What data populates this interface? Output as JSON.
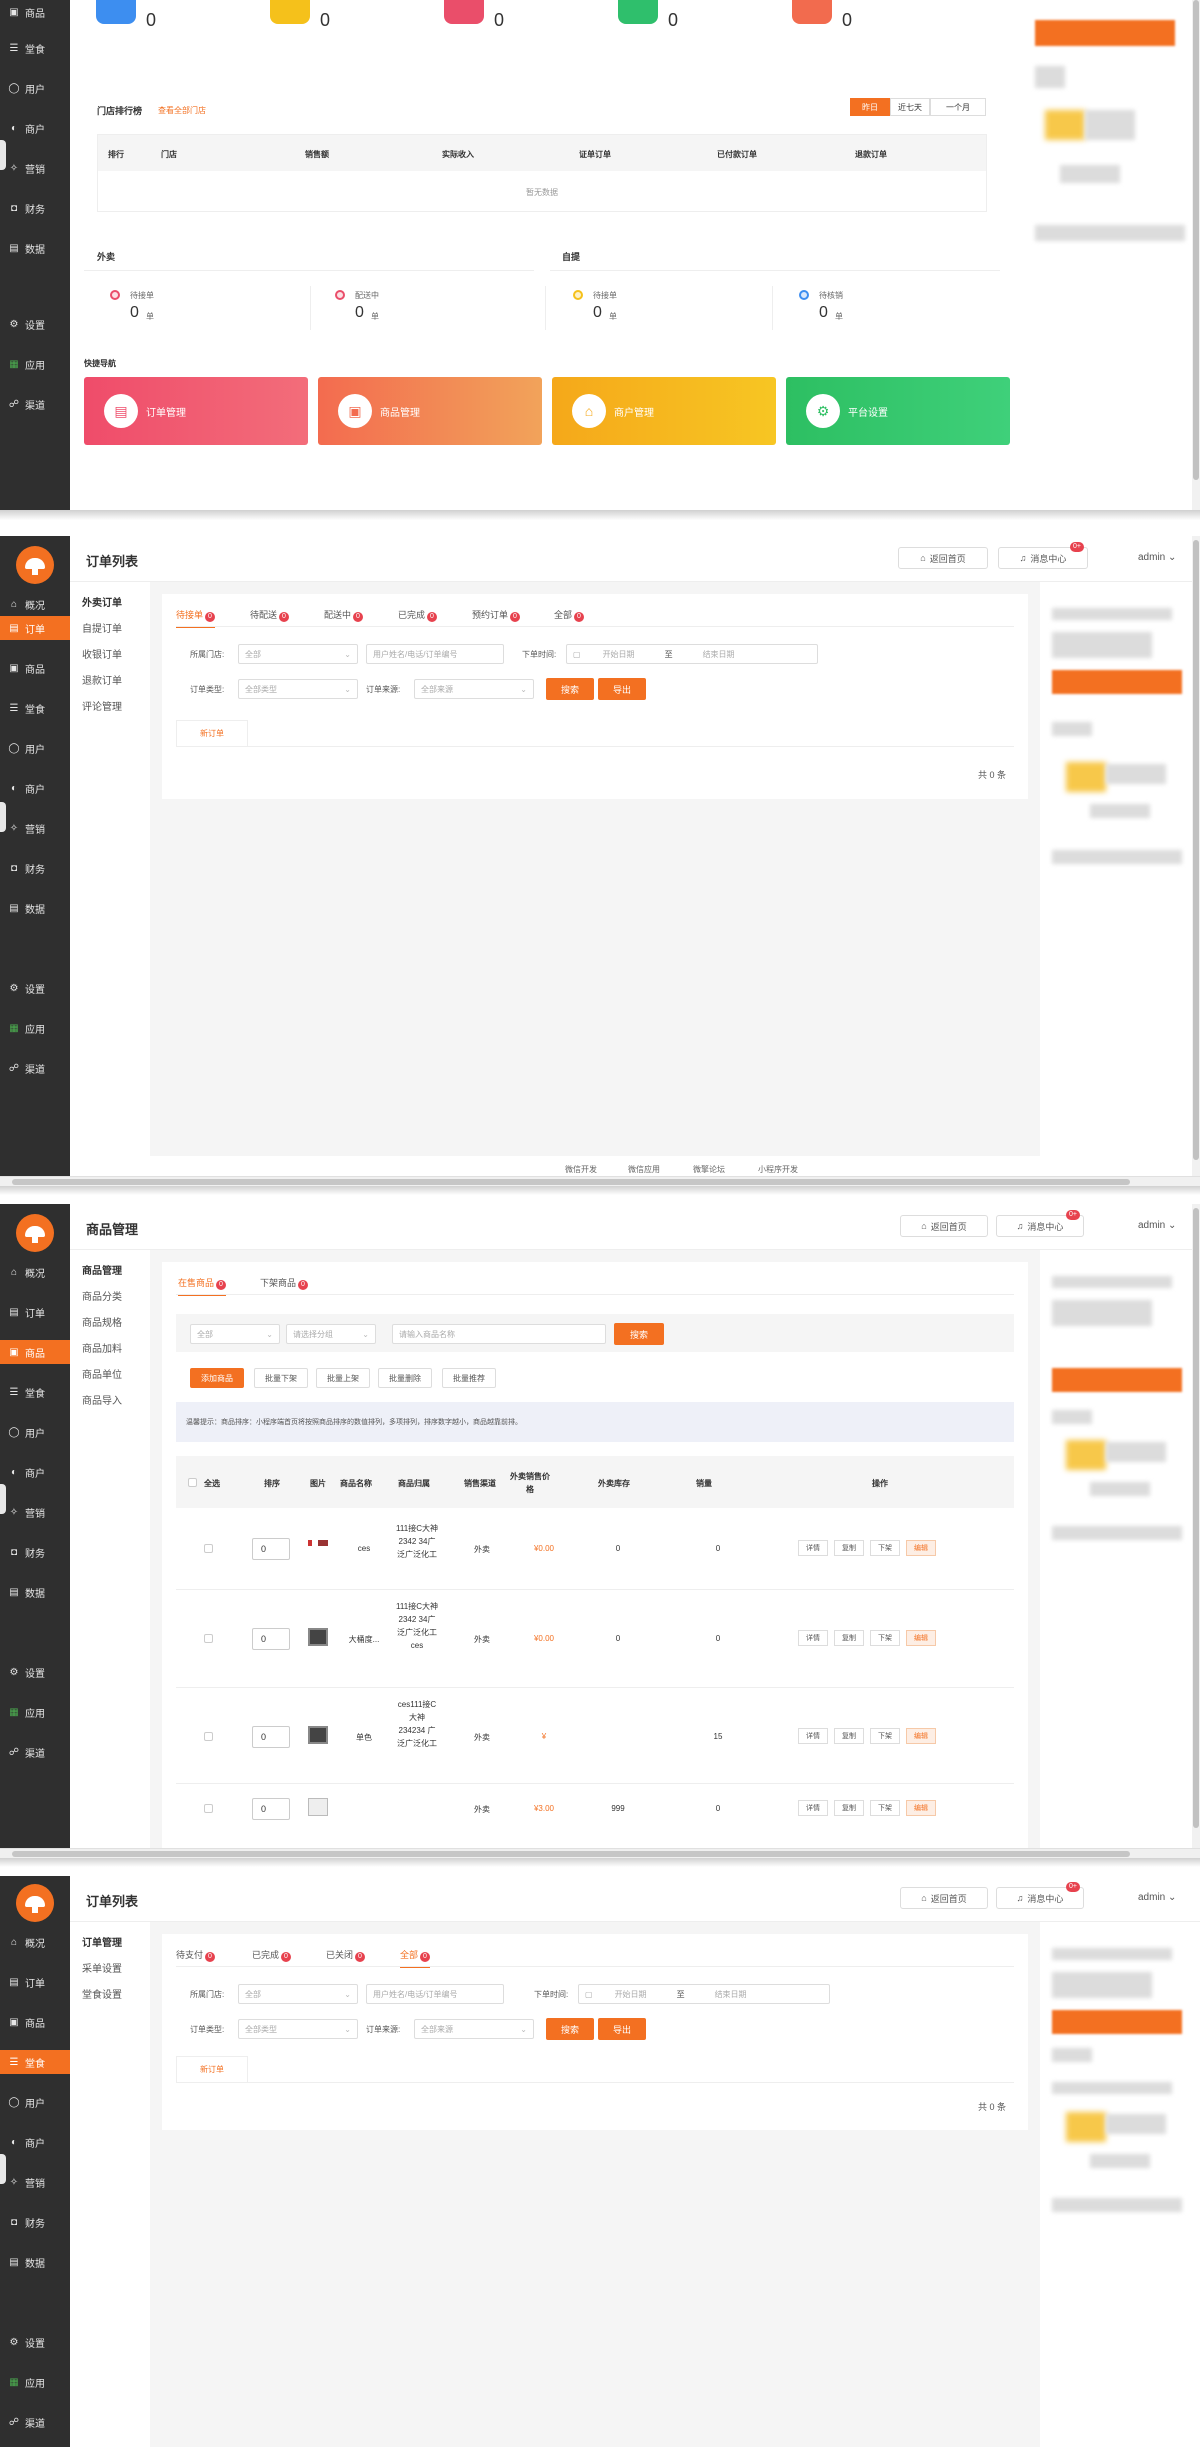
{
  "nav": {
    "overview": "概况",
    "orders": "订单",
    "products": "商品",
    "dining": "堂食",
    "users": "用户",
    "merchants": "商户",
    "marketing": "营销",
    "finance": "财务",
    "data": "数据",
    "settings": "设置",
    "apps": "应用",
    "channels": "渠道"
  },
  "top": {
    "return_home": "返回首页",
    "messages": "消息中心",
    "msg_badge": "0+",
    "admin": "admin"
  },
  "shot1": {
    "stats": [
      "0",
      "0",
      "0",
      "0",
      "0"
    ],
    "rank_title": "门店排行榜",
    "rank_link": "查看全部门店",
    "range_tabs": [
      "昨日",
      "近七天",
      "一个月"
    ],
    "rank_headers": [
      "排行",
      "门店",
      "销售额",
      "实际收入",
      "证单订单",
      "已付款订单",
      "退款订单"
    ],
    "empty": "暂无数据",
    "takeout_title": "外卖",
    "pickup_title": "自提",
    "status": [
      {
        "label": "待接单",
        "value": "0",
        "unit": "单"
      },
      {
        "label": "配送中",
        "value": "0",
        "unit": "单"
      },
      {
        "label": "待接单",
        "value": "0",
        "unit": "单"
      },
      {
        "label": "待核销",
        "value": "0",
        "unit": "单"
      }
    ],
    "quick_title": "快捷导航",
    "quick": [
      "订单管理",
      "商品管理",
      "商户管理",
      "平台设置"
    ]
  },
  "shot2": {
    "title": "订单列表",
    "subnav": [
      "外卖订单",
      "自提订单",
      "收银订单",
      "退款订单",
      "评论管理"
    ],
    "tabs": [
      {
        "label": "待接单",
        "badge": "0"
      },
      {
        "label": "待配送",
        "badge": "0"
      },
      {
        "label": "配送中",
        "badge": "0"
      },
      {
        "label": "已完成",
        "badge": "0"
      },
      {
        "label": "预约订单",
        "badge": "0"
      },
      {
        "label": "全部",
        "badge": "0"
      }
    ],
    "store_label": "所属门店:",
    "store_value": "全部",
    "search_placeholder": "用户姓名/电话/订单编号",
    "time_label": "下单时间:",
    "start_date": "开始日期",
    "to": "至",
    "end_date": "结束日期",
    "type_label": "订单类型:",
    "type_value": "全部类型",
    "source_label": "订单来源:",
    "source_value": "全部来源",
    "search_btn": "搜索",
    "export_btn": "导出",
    "new_order_tab": "新订单",
    "total": "共 0 条",
    "footer": [
      "微信开发",
      "微信应用",
      "微擎论坛",
      "小程序开发"
    ]
  },
  "shot3": {
    "title": "商品管理",
    "subnav": [
      "商品管理",
      "商品分类",
      "商品规格",
      "商品加料",
      "商品单位",
      "商品导入"
    ],
    "tabs": [
      {
        "label": "在售商品",
        "badge": "0"
      },
      {
        "label": "下架商品",
        "badge": "0"
      }
    ],
    "filter_all": "全部",
    "filter_cat": "请选择分组",
    "search_placeholder": "请输入商品名称",
    "search_btn": "搜索",
    "actions": [
      "添加商品",
      "批量下架",
      "批量上架",
      "批量删除",
      "批量推荐"
    ],
    "tip": "温馨提示：商品排序：小程序端首页将按照商品排序的数值排列，多项排列，排序数字越小，商品越靠前排。",
    "headers": [
      "全选",
      "排序",
      "图片",
      "商品名称",
      "商品归属",
      "销售渠道",
      "外卖销售价格",
      "外卖库存",
      "销量",
      "操作"
    ],
    "rows": [
      {
        "sort": "0",
        "name": "ces",
        "belong": "111接C大神2342 34广泛广泛化工",
        "channel": "外卖",
        "price": "¥0.00",
        "stock": "0",
        "sales": "0"
      },
      {
        "sort": "0",
        "name": "大桶度...",
        "belong": "111接C大神2342 34广泛广泛化工 ces",
        "channel": "外卖",
        "price": "¥0.00",
        "stock": "0",
        "sales": "0"
      },
      {
        "sort": "0",
        "name": "单色",
        "belong": "ces111接C大神234234 广泛广泛化工",
        "channel": "外卖",
        "price": "¥",
        "stock": "",
        "sales": "15"
      },
      {
        "sort": "0",
        "name": "",
        "belong": "",
        "channel": "外卖",
        "price": "¥3.00",
        "stock": "999",
        "sales": "0"
      }
    ],
    "row_buttons": [
      "详情",
      "复制",
      "下架",
      "编辑"
    ]
  },
  "shot4": {
    "title": "订单列表",
    "subnav": [
      "订单管理",
      "采单设置",
      "堂食设置"
    ],
    "tabs": [
      {
        "label": "待支付",
        "badge": "0"
      },
      {
        "label": "已完成",
        "badge": "0"
      },
      {
        "label": "已关闭",
        "badge": "0"
      },
      {
        "label": "全部",
        "badge": "0"
      }
    ],
    "new_order_tab": "新订单",
    "total": "共 0 条"
  },
  "colors": {
    "accent": "#f37021",
    "sidebar": "#2f2f2f",
    "blue": "#3d8ef0",
    "yellow": "#f5c11b",
    "pink": "#ea4e6a",
    "green": "#2fbf6c",
    "coral": "#f26b4e"
  }
}
